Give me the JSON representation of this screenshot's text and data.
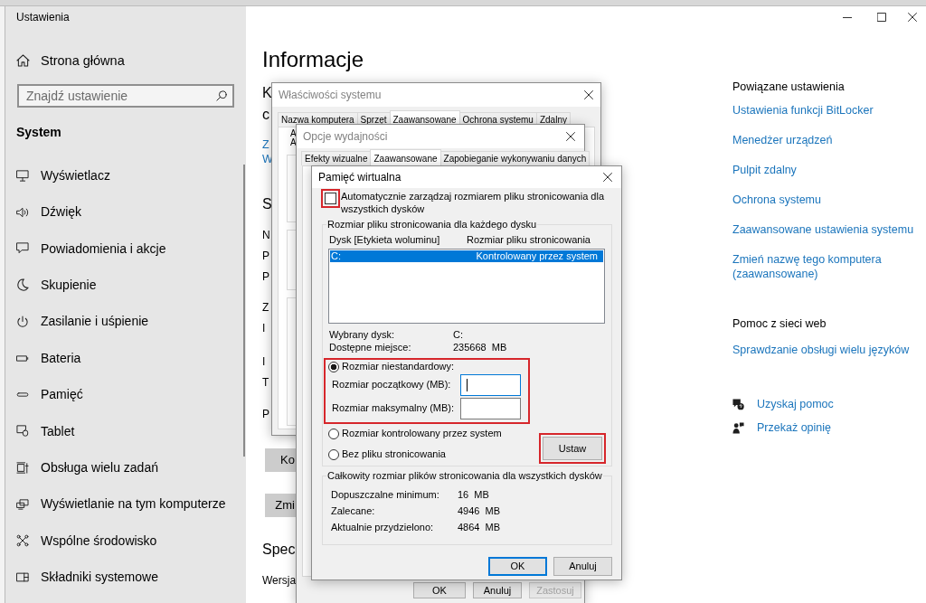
{
  "settings": {
    "title": "Ustawienia",
    "home": "Strona główna",
    "search": {
      "placeholder": "Znajdź ustawienie"
    },
    "category": "System",
    "sidebar_items": [
      {
        "label": "Wyświetlacz"
      },
      {
        "label": "Dźwięk"
      },
      {
        "label": "Powiadomienia i akcje"
      },
      {
        "label": "Skupienie"
      },
      {
        "label": "Zasilanie i uśpienie"
      },
      {
        "label": "Bateria"
      },
      {
        "label": "Pamięć"
      },
      {
        "label": "Tablet"
      },
      {
        "label": "Obsługa wielu zadań"
      },
      {
        "label": "Wyświetlanie na tym komputerze"
      },
      {
        "label": "Wspólne środowisko"
      },
      {
        "label": "Składniki systemowe"
      }
    ]
  },
  "main": {
    "title": "Informacje",
    "fragments": [
      {
        "kind": "subheading",
        "text": "K"
      },
      {
        "kind": "subheading",
        "text": "c"
      },
      {
        "kind": "link",
        "text": "Z"
      },
      {
        "kind": "link",
        "text": "W"
      },
      {
        "kind": "heading",
        "text": "S"
      },
      {
        "kind": "label",
        "text": "N"
      },
      {
        "kind": "label",
        "text": "P"
      },
      {
        "kind": "label",
        "text": "P"
      },
      {
        "kind": "label",
        "text": "Z"
      },
      {
        "kind": "label",
        "text": "I"
      },
      {
        "kind": "label",
        "text": "I"
      },
      {
        "kind": "label",
        "text": "T"
      },
      {
        "kind": "label",
        "text": "P"
      },
      {
        "kind": "button",
        "text": "Ko"
      },
      {
        "kind": "button",
        "text": "Zmi"
      },
      {
        "kind": "heading",
        "text": "Spec"
      },
      {
        "kind": "label",
        "text": "Wersja"
      }
    ]
  },
  "related_settings": {
    "title": "Powiązane ustawienia",
    "links": [
      "Ustawienia funkcji BitLocker",
      "Menedżer urządzeń",
      "Pulpit zdalny",
      "Ochrona systemu",
      "Zaawansowane ustawienia systemu",
      "Zmień nazwę tego komputera (zaawansowane)"
    ]
  },
  "web_help": {
    "title": "Pomoc z sieci web",
    "links": [
      "Sprawdzanie obsługi wielu języków"
    ]
  },
  "support_links": [
    {
      "kind": "help",
      "label": "Uzyskaj pomoc"
    },
    {
      "kind": "feedback",
      "label": "Przekaż opinię"
    }
  ],
  "system_properties": {
    "title": "Właściwości systemu",
    "active": false,
    "tabs": [
      {
        "label": "Nazwa komputera",
        "selected": false
      },
      {
        "label": "Sprzęt",
        "selected": false
      },
      {
        "label": "Zaawansowane",
        "selected": true
      },
      {
        "label": "Ochrona systemu",
        "selected": false
      },
      {
        "label": "Zdalny",
        "selected": false
      }
    ],
    "fragments": [
      "A",
      "A"
    ]
  },
  "performance_options": {
    "title": "Opcje wydajności",
    "active": false,
    "tabs": [
      {
        "label": "Efekty wizualne",
        "selected": false
      },
      {
        "label": "Zaawansowane",
        "selected": true
      },
      {
        "label": "Zapobieganie wykonywaniu danych",
        "selected": false
      }
    ],
    "buttons": [
      {
        "label": "OK",
        "disabled": false
      },
      {
        "label": "Anuluj",
        "disabled": false
      },
      {
        "label": "Zastosuj",
        "disabled": true
      }
    ]
  },
  "virtual_memory": {
    "title": "Pamięć wirtualna",
    "active": true,
    "auto_manage": {
      "label": "Automatycznie zarządzaj rozmiarem pliku stronicowania dla wszystkich dysków",
      "checked": false,
      "highlighted": true
    },
    "per_drive": {
      "title": "Rozmiar pliku stronicowania dla każdego dysku",
      "columns": [
        "Dysk [Etykieta woluminu]",
        "Rozmiar pliku stronicowania"
      ],
      "rows": [
        {
          "drive": "C:",
          "size": "Kontrolowany przez system",
          "selected": true
        }
      ],
      "info": [
        {
          "label": "Wybrany dysk:",
          "value": "C:"
        },
        {
          "label": "Dostępne miejsce:",
          "value": "235668  MB"
        }
      ],
      "options": [
        {
          "label": "Rozmiar niestandardowy:",
          "selected": true,
          "highlighted": true,
          "fields": [
            {
              "label": "Rozmiar początkowy (MB):",
              "focused": true
            },
            {
              "label": "Rozmiar maksymalny (MB):",
              "focused": false
            }
          ]
        },
        {
          "label": "Rozmiar kontrolowany przez system",
          "selected": false,
          "highlighted": false
        },
        {
          "label": "Bez pliku stronicowania",
          "selected": false,
          "highlighted": false
        }
      ],
      "set_button": {
        "label": "Ustaw",
        "highlighted": true
      }
    },
    "totals": {
      "title": "Całkowity rozmiar plików stronicowania dla wszystkich dysków",
      "rows": [
        {
          "label": "Dopuszczalne minimum:",
          "value": "16  MB"
        },
        {
          "label": "Zalecane:",
          "value": "4946  MB"
        },
        {
          "label": "Aktualnie przydzielono:",
          "value": "4864  MB"
        }
      ]
    },
    "buttons": [
      {
        "label": "OK",
        "default": true
      },
      {
        "label": "Anuluj",
        "default": false
      }
    ]
  }
}
